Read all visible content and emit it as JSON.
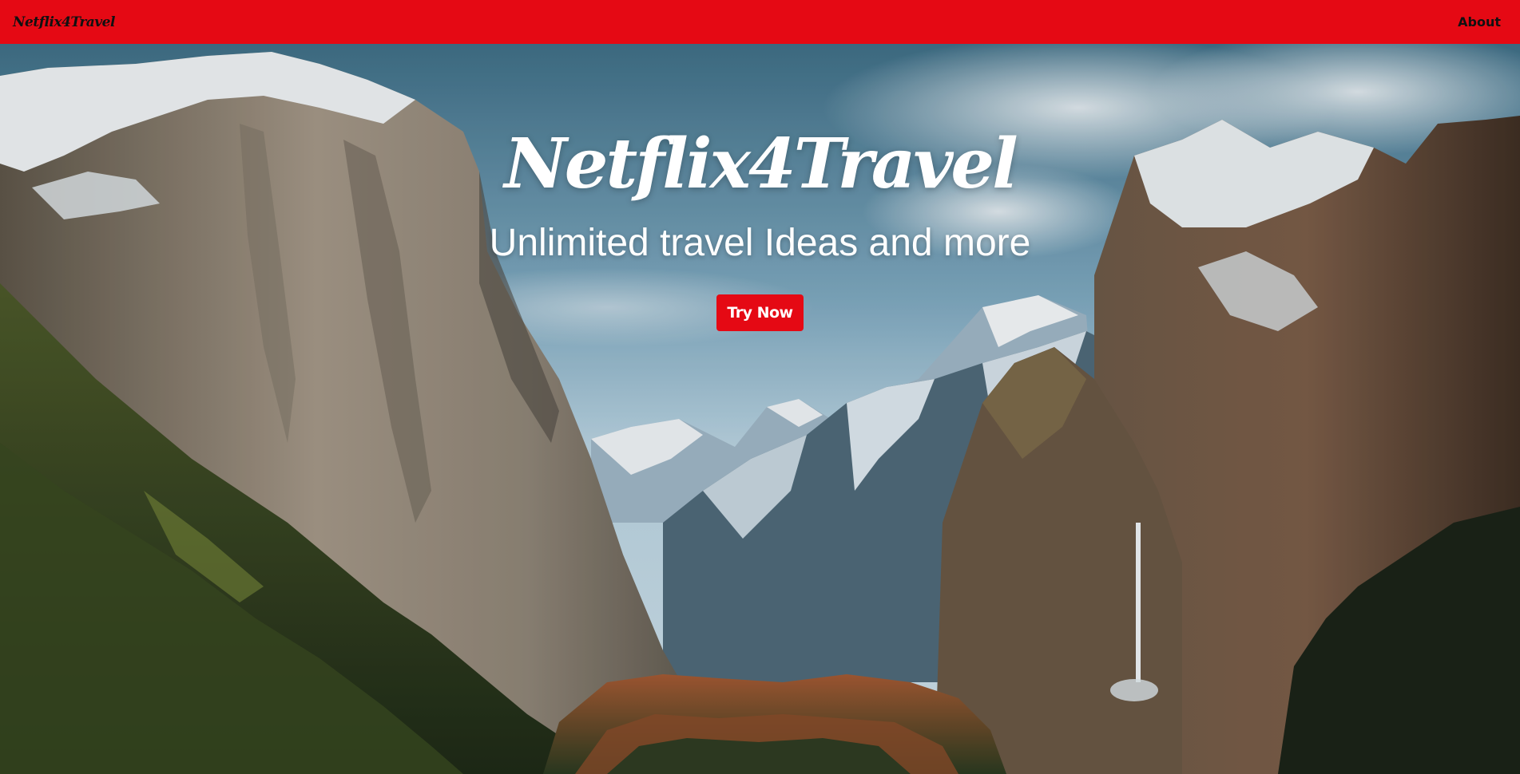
{
  "navbar": {
    "brand": "Netflix4Travel",
    "about_link": "About",
    "color": "#e50914"
  },
  "hero": {
    "title": "Netflix4Travel",
    "subtitle": "Unlimited travel Ideas and more",
    "cta_label": "Try Now",
    "background_image": "mountain-valley-landscape"
  }
}
